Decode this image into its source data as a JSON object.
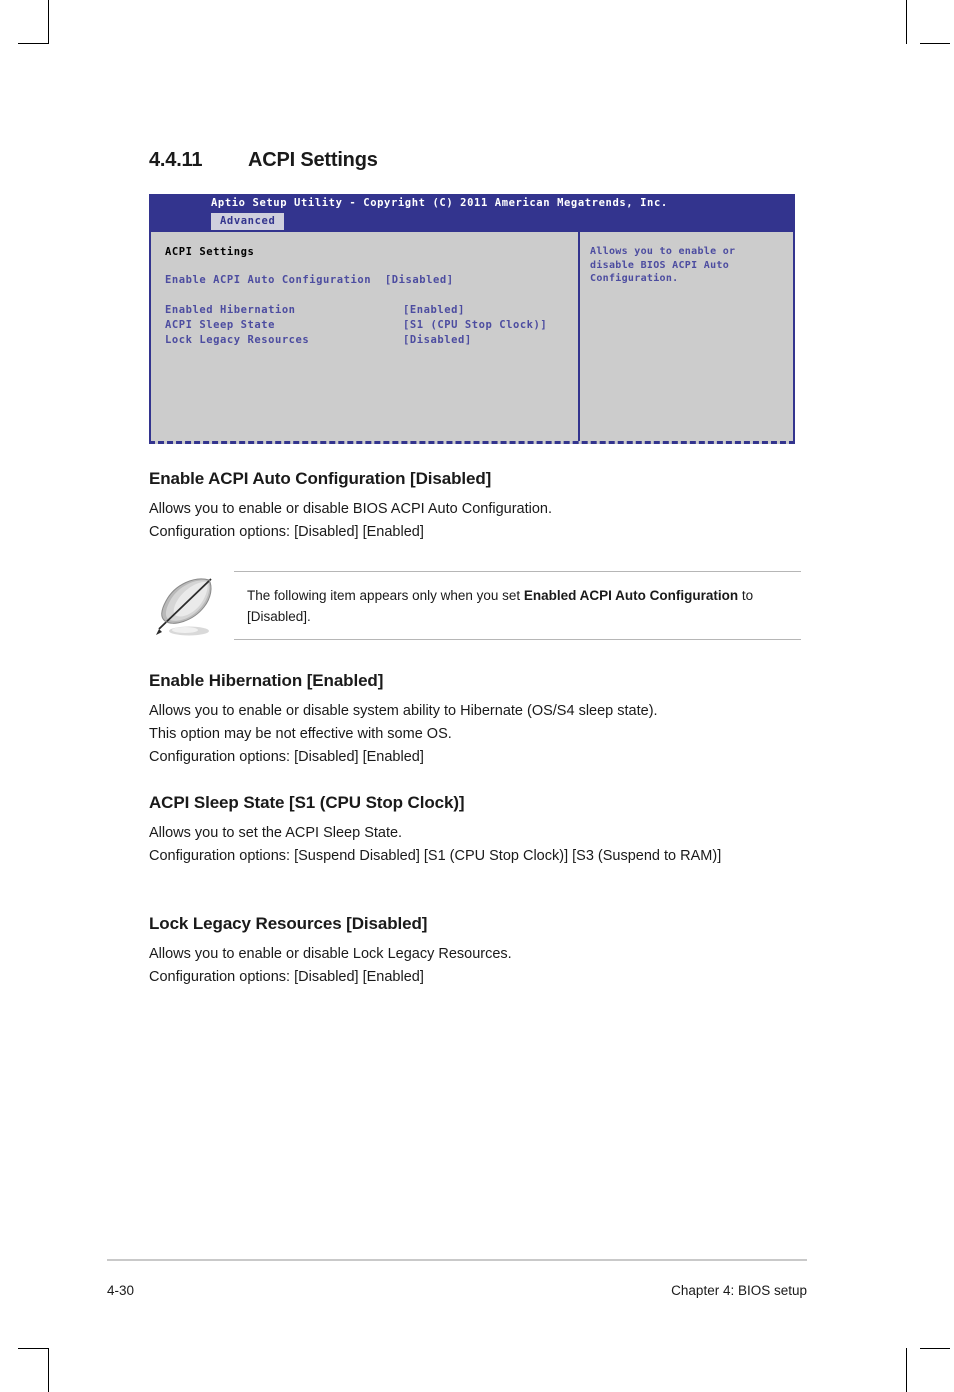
{
  "section": {
    "number": "4.4.11",
    "title": "ACPI Settings"
  },
  "bios": {
    "titlebar": "Aptio Setup Utility - Copyright (C) 2011 American Megatrends, Inc.",
    "active_tab": "Advanced",
    "panel_heading": "ACPI Settings",
    "items": [
      {
        "label": "Enable ACPI Auto Configuration",
        "value": "[Disabled]",
        "inline": true
      },
      {
        "label": "Enabled Hibernation",
        "value": "[Enabled]",
        "inline": false
      },
      {
        "label": "ACPI Sleep State",
        "value": "[S1 (CPU Stop Clock)]",
        "inline": false
      },
      {
        "label": "Lock Legacy Resources",
        "value": "[Disabled]",
        "inline": false
      }
    ],
    "help": [
      "Allows you to enable or",
      "disable BIOS ACPI Auto",
      "Configuration."
    ]
  },
  "sections": [
    {
      "heading": "Enable ACPI Auto Configuration [Disabled]",
      "lines": [
        "Allows you to enable or disable BIOS ACPI Auto Configuration.",
        "Configuration options: [Disabled] [Enabled]"
      ]
    },
    {
      "heading": "Enable Hibernation [Enabled]",
      "lines": [
        "Allows you to enable or disable system ability to Hibernate (OS/S4 sleep state).",
        "This option may be not effective with some OS.",
        "Configuration options: [Disabled] [Enabled]"
      ]
    },
    {
      "heading": "ACPI Sleep State [S1 (CPU Stop Clock)]",
      "lines": [
        "Allows you to set the ACPI Sleep State.",
        "Configuration options: [Suspend Disabled] [S1 (CPU Stop Clock)] [S3 (Suspend to RAM)]"
      ]
    },
    {
      "heading": "Lock Legacy Resources [Disabled]",
      "lines": [
        "Allows you to enable or disable Lock Legacy Resources.",
        "Configuration options: [Disabled] [Enabled]"
      ]
    }
  ],
  "note": {
    "icon": "note-feather-icon",
    "text_part1": "The following item appears only when you set ",
    "text_bold": "Enabled ACPI Auto Configuration",
    "text_part2": " to [Disabled]."
  },
  "footer": {
    "page_number": "4-30",
    "chapter": "Chapter 4: BIOS setup"
  },
  "colors": {
    "bios_blue": "#33348e",
    "bios_text_blue": "#4c4ca0",
    "bios_panel_gray": "#cccccc",
    "tab_gray": "#cfcfdd"
  }
}
